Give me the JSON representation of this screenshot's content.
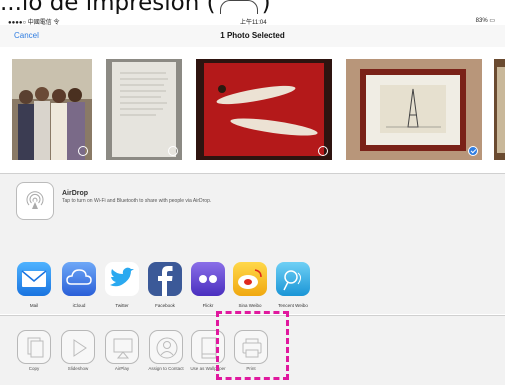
{
  "caption": {
    "prefix": "...io de impresión (",
    "suffix": ")"
  },
  "status": {
    "carrier": "●●●●○ 中國電信 令",
    "time": "上午11:04",
    "battery": "83% ▭"
  },
  "nav": {
    "cancel": "Cancel",
    "title": "1 Photo Selected"
  },
  "photos": [
    {
      "name": "group-photo",
      "selected": false
    },
    {
      "name": "document-photo",
      "selected": false
    },
    {
      "name": "painting-photo",
      "selected": false
    },
    {
      "name": "eiffel-print-photo",
      "selected": true
    },
    {
      "name": "partial-photo",
      "selected": false
    }
  ],
  "airdrop": {
    "title": "AirDrop",
    "subtitle": "Tap to turn on Wi-Fi and Bluetooth to share with people via AirDrop."
  },
  "share_apps": [
    {
      "label": "Mail",
      "icon": "mail-icon",
      "color": "#1e8ff2"
    },
    {
      "label": "iCloud",
      "icon": "cloud-icon",
      "color": "#2a7fe8"
    },
    {
      "label": "Twitter",
      "icon": "twitter-icon",
      "color": "#2aa9f0"
    },
    {
      "label": "Facebook",
      "icon": "facebook-icon",
      "color": "#3b5998"
    },
    {
      "label": "Flickr",
      "icon": "flickr-icon",
      "color": "#5a48c9"
    },
    {
      "label": "Sina Weibo",
      "icon": "weibo-icon",
      "color": "#f4c21f"
    },
    {
      "label": "Tencent Weibo",
      "icon": "tencent-weibo-icon",
      "color": "#2aa9e6"
    }
  ],
  "actions": [
    {
      "label": "Copy",
      "icon": "copy-icon"
    },
    {
      "label": "Slideshow",
      "icon": "play-icon"
    },
    {
      "label": "AirPlay",
      "icon": "airplay-icon"
    },
    {
      "label": "Assign to Contact",
      "icon": "contact-icon"
    },
    {
      "label": "Use as Wallpaper",
      "icon": "wallpaper-icon"
    },
    {
      "label": "Print",
      "icon": "print-icon"
    }
  ],
  "colors": {
    "accent": "#2f7de1",
    "highlight": "#e0189e"
  }
}
